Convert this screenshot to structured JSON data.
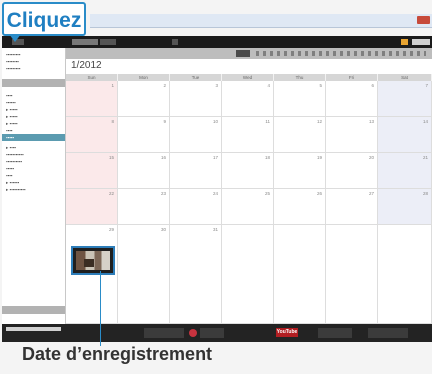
{
  "annotation": {
    "callout_label": "Cliquez",
    "caption": "Date d’enregistrement",
    "accent_color": "#2a8cc8"
  },
  "calendar": {
    "month_label": "1/2012",
    "weekdays": [
      "Sun",
      "Mon",
      "Tue",
      "Wed",
      "Thu",
      "Fri",
      "Sat"
    ],
    "weeks": [
      [
        "1",
        "2",
        "3",
        "4",
        "5",
        "6",
        "7"
      ],
      [
        "8",
        "9",
        "10",
        "11",
        "12",
        "13",
        "14"
      ],
      [
        "15",
        "16",
        "17",
        "18",
        "19",
        "20",
        "21"
      ],
      [
        "22",
        "23",
        "24",
        "25",
        "26",
        "27",
        "28"
      ],
      [
        "29",
        "30",
        "31",
        "",
        "",
        "",
        ""
      ]
    ]
  },
  "bottom_bar": {
    "youtube_label": "YouTube"
  }
}
